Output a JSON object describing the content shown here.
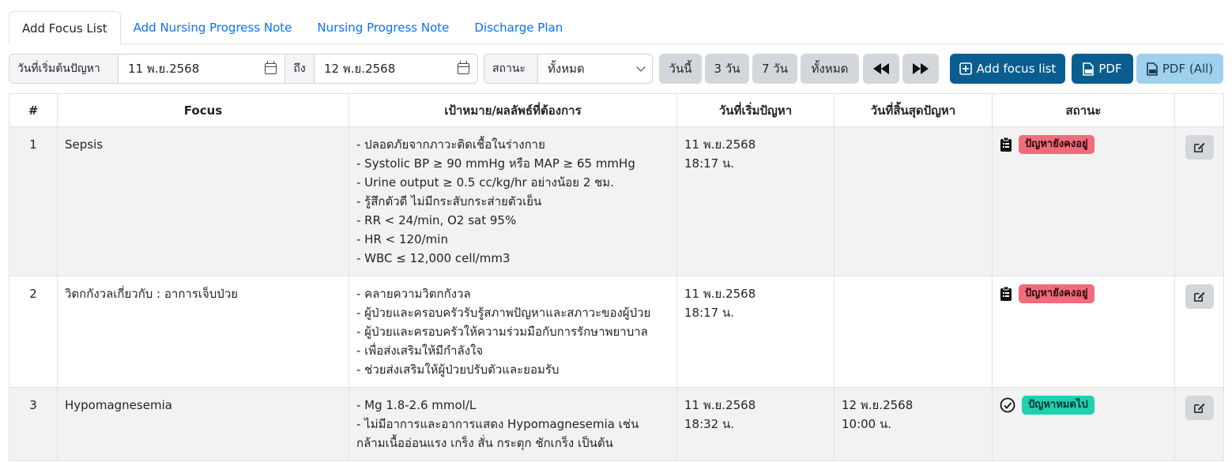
{
  "tabs": [
    {
      "label": "Add Focus List",
      "active": true
    },
    {
      "label": "Add Nursing Progress Note",
      "active": false
    },
    {
      "label": "Nursing Progress Note",
      "active": false
    },
    {
      "label": "Discharge Plan",
      "active": false
    }
  ],
  "filters": {
    "start_label": "วันที่เริ่มต้นปัญหา",
    "start_value": "11 พ.ย.2568",
    "to_label": "ถึง",
    "end_value": "12 พ.ย.2568",
    "status_label": "สถานะ",
    "status_value": "ทั้งหมด"
  },
  "quick_buttons": {
    "today": "วันนี้",
    "three_days": "3 วัน",
    "seven_days": "7 วัน",
    "all": "ทั้งหมด"
  },
  "actions": {
    "add_focus": "Add focus list",
    "pdf": "PDF",
    "pdf_all": "PDF (All)"
  },
  "colors": {
    "primary_dark": "#0a5d8f",
    "primary_light": "#9fd0ee",
    "badge_active": "#f06c7c",
    "badge_resolved": "#1fd1b0"
  },
  "table": {
    "headers": {
      "num": "#",
      "focus": "Focus",
      "goal": "เป้าหมาย/ผลลัพธ์ที่ต้องการ",
      "start": "วันที่เริ่มปัญหา",
      "end": "วันที่สิ้นสุดปัญหา",
      "status": "สถานะ"
    },
    "rows": [
      {
        "num": "1",
        "focus": "Sepsis",
        "goals": [
          "- ปลอดภัยจากภาวะติดเชื้อในร่างกาย",
          "- Systolic BP ≥ 90 mmHg หรือ MAP ≥ 65 mmHg",
          "- Urine output ≥ 0.5 cc/kg/hr อย่างน้อย 2 ชม.",
          "- รู้สึกตัวดี ไม่มีกระสับกระส่ายตัวเย็น",
          "- RR < 24/min, O2 sat 95%",
          "- HR < 120/min",
          "- WBC ≤ 12,000 cell/mm3"
        ],
        "start_date": "11 พ.ย.2568",
        "start_time": "18:17 น.",
        "end_date": "",
        "end_time": "",
        "status": "ปัญหายังคงอยู่",
        "status_icon": "clipboard-list-icon"
      },
      {
        "num": "2",
        "focus": "วิตกกังวลเกี่ยวกับ : อาการเจ็บป่วย",
        "goals": [
          "- คลายความวิตกกังวล",
          "- ผู้ป่วยและครอบครัวรับรู้สภาพปัญหาและสภาวะของผู้ป่วย",
          "- ผู้ป่วยและครอบครัวให้ความร่วมมือกับการรักษาพยาบาล",
          "- เพื่อส่งเสริมให้มีกำลังใจ",
          "- ช่วยส่งเสริมให้ผู้ป่วยปรับตัวและยอมรับ"
        ],
        "start_date": "11 พ.ย.2568",
        "start_time": "18:17 น.",
        "end_date": "",
        "end_time": "",
        "status": "ปัญหายังคงอยู่",
        "status_icon": "clipboard-list-icon"
      },
      {
        "num": "3",
        "focus": "Hypomagnesemia",
        "goals": [
          "- Mg 1.8-2.6 mmol/L",
          "- ไม่มีอาการและอาการแสดง Hypomagnesemia เช่น กล้ามเนื้ออ่อนแรง เกร็ง สั่น กระตุก ชักเกร็ง เป็นต้น"
        ],
        "start_date": "11 พ.ย.2568",
        "start_time": "18:32 น.",
        "end_date": "12 พ.ย.2568",
        "end_time": "10:00 น.",
        "status": "ปัญหาหมดไป",
        "status_icon": "check-circle-icon"
      }
    ]
  }
}
